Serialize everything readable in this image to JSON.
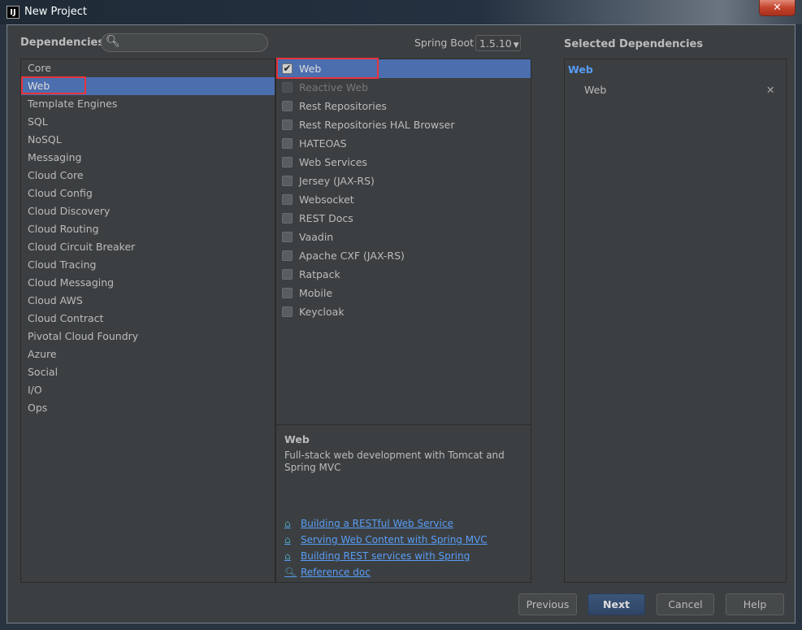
{
  "window": {
    "title": "New Project",
    "icon": "IJ",
    "close": "✕"
  },
  "header": {
    "dependencies_label": "Dependencies",
    "search_placeholder": "",
    "spring_boot_label": "Spring Boot",
    "spring_boot_version": "1.5.10"
  },
  "categories": [
    "Core",
    "Web",
    "Template Engines",
    "SQL",
    "NoSQL",
    "Messaging",
    "Cloud Core",
    "Cloud Config",
    "Cloud Discovery",
    "Cloud Routing",
    "Cloud Circuit Breaker",
    "Cloud Tracing",
    "Cloud Messaging",
    "Cloud AWS",
    "Cloud Contract",
    "Pivotal Cloud Foundry",
    "Azure",
    "Social",
    "I/O",
    "Ops"
  ],
  "dependencies": [
    {
      "label": "Web",
      "checked": true,
      "enabled": true
    },
    {
      "label": "Reactive Web",
      "checked": false,
      "enabled": false
    },
    {
      "label": "Rest Repositories",
      "checked": false,
      "enabled": true
    },
    {
      "label": "Rest Repositories HAL Browser",
      "checked": false,
      "enabled": true
    },
    {
      "label": "HATEOAS",
      "checked": false,
      "enabled": true
    },
    {
      "label": "Web Services",
      "checked": false,
      "enabled": true
    },
    {
      "label": "Jersey (JAX-RS)",
      "checked": false,
      "enabled": true
    },
    {
      "label": "Websocket",
      "checked": false,
      "enabled": true
    },
    {
      "label": "REST Docs",
      "checked": false,
      "enabled": true
    },
    {
      "label": "Vaadin",
      "checked": false,
      "enabled": true
    },
    {
      "label": "Apache CXF (JAX-RS)",
      "checked": false,
      "enabled": true
    },
    {
      "label": "Ratpack",
      "checked": false,
      "enabled": true
    },
    {
      "label": "Mobile",
      "checked": false,
      "enabled": true
    },
    {
      "label": "Keycloak",
      "checked": false,
      "enabled": true
    }
  ],
  "description": {
    "title": "Web",
    "text": "Full-stack web development with Tomcat and Spring MVC",
    "links": [
      {
        "label": "Building a RESTful Web Service",
        "icon": "guide-icon"
      },
      {
        "label": "Serving Web Content with Spring MVC",
        "icon": "guide-icon"
      },
      {
        "label": "Building REST services with Spring",
        "icon": "guide-icon"
      },
      {
        "label": "Reference doc",
        "icon": "reference-icon"
      }
    ]
  },
  "selected": {
    "title": "Selected Dependencies",
    "group": "Web",
    "items": [
      "Web"
    ],
    "remove": "✕"
  },
  "buttons": {
    "previous": "Previous",
    "next": "Next",
    "cancel": "Cancel",
    "help": "Help"
  },
  "colors": {
    "selection": "#4b6eaf",
    "link": "#589df6",
    "highlight": "#e8333a"
  }
}
